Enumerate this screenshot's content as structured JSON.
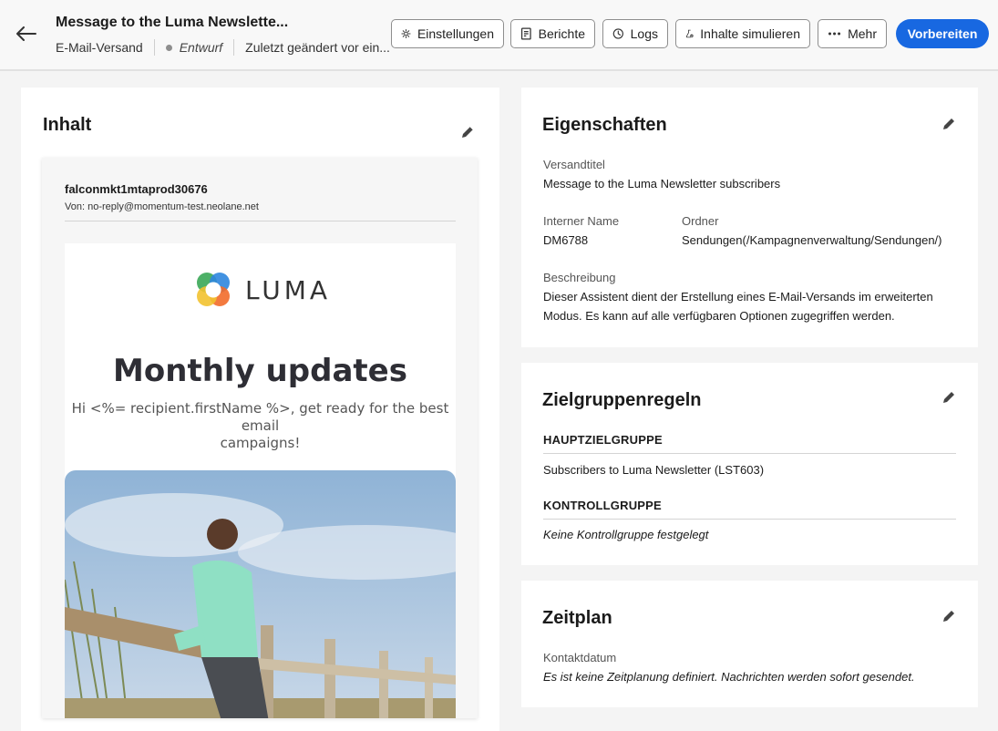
{
  "header": {
    "title": "Message to the Luma Newslette...",
    "channel": "E-Mail-Versand",
    "status": "Entwurf",
    "modified": "Zuletzt geändert vor ein...",
    "buttons": {
      "settings": "Einstellungen",
      "reports": "Berichte",
      "logs": "Logs",
      "simulate": "Inhalte simulieren",
      "more": "Mehr",
      "prepare": "Vorbereiten"
    },
    "icons": [
      "back-arrow-icon",
      "gear-icon",
      "report-icon",
      "clock-icon",
      "flask-icon",
      "more-icon"
    ]
  },
  "content": {
    "title": "Inhalt",
    "email": {
      "sender": "falconmkt1mtaprod30676",
      "from": "Von: no-reply@momentum-test.neolane.net",
      "logo_text": "LUMA",
      "headline": "Monthly updates",
      "greeting_line1": "Hi <%= recipient.firstName %>, get ready for the best email",
      "greeting_line2": "campaigns!"
    }
  },
  "properties": {
    "title": "Eigenschaften",
    "delivery_label": "Versandtitel",
    "delivery_value": "Message to the Luma Newsletter subscribers",
    "internal_label": "Interner Name",
    "internal_value": "DM6788",
    "folder_label": "Ordner",
    "folder_value": "Sendungen(/Kampagnenverwaltung/Sendungen/)",
    "description_label": "Beschreibung",
    "description_line1": "Dieser Assistent dient der Erstellung eines E-Mail-Versands im erweiterten",
    "description_line2": "Modus.  Es kann auf alle verfügbaren Optionen zugegriffen werden."
  },
  "audience": {
    "title": "Zielgruppenregeln",
    "main_head": "HAUPTZIELGRUPPE",
    "main_value": "Subscribers to Luma Newsletter (LST603)",
    "control_head": "KONTROLLGRUPPE",
    "control_value": "Keine Kontrollgruppe festgelegt"
  },
  "schedule": {
    "title": "Zeitplan",
    "contact_label": "Kontaktdatum",
    "contact_value": "Es ist keine Zeitplanung definiert. Nachrichten werden sofort gesendet."
  },
  "colors": {
    "primary": "#1868e1",
    "background": "#f4f4f4",
    "panel": "#ffffff"
  }
}
